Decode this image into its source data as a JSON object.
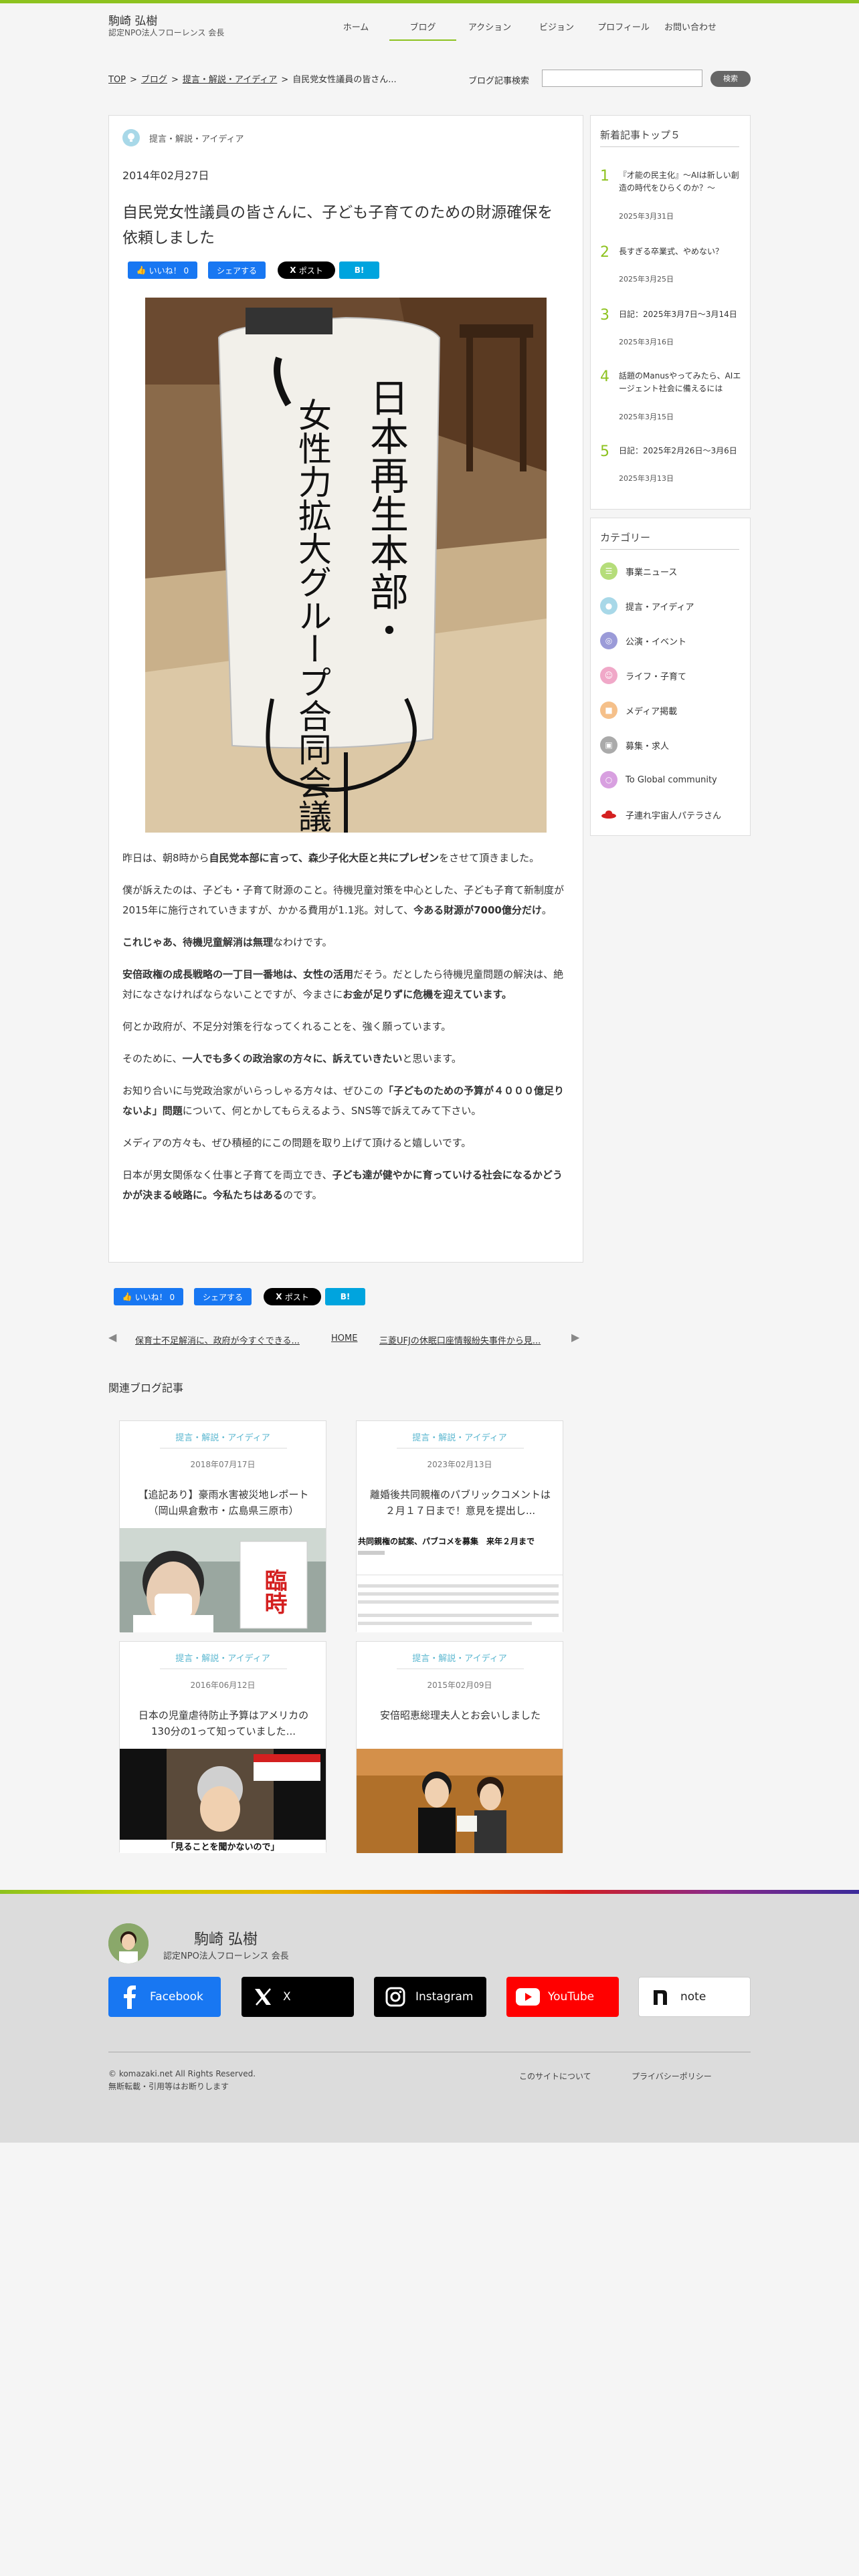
{
  "header": {
    "site_name": "駒崎 弘樹",
    "site_sub": "認定NPO法人フローレンス 会長",
    "nav": [
      "ホーム",
      "ブログ",
      "アクション",
      "ビジョン",
      "プロフィール",
      "お問い合わせ"
    ]
  },
  "breadcrumb": {
    "top": "TOP",
    "blog": "ブログ",
    "category": "提言・解説・アイディア",
    "current": "自民党女性議員の皆さん..."
  },
  "search": {
    "label": "ブログ記事検索",
    "button": "検索"
  },
  "article": {
    "category": "提言・解説・アイディア",
    "date": "2014年02月27日",
    "title": "自民党女性議員の皆さんに、子ども子育てのための財源確保を依頼しました",
    "photo_text": {
      "line1": "日本再生本部・",
      "line2": "女性力拡大グループ合同会議"
    },
    "paragraphs": [
      [
        "昨日は、朝8時から",
        "自民党本部に言って、森少子化大臣と共にプレゼン",
        "をさせて頂きました。"
      ],
      [
        "僕が訴えたのは、子ども・子育て財源のこと。待機児童対策を中心とした、子ども子育て新制度が2015年に施行されていきますが、かかる費用が1.1兆。対して、",
        "今ある財源が7000億分だけ",
        "。"
      ],
      [
        "",
        "これじゃあ、待機児童解消は無理",
        "なわけです。"
      ],
      [
        "",
        "安倍政権の成長戦略の一丁目一番地は、女性の活用",
        "だそう。だとしたら待機児童問題の解決は、絶対になさなければならないことですが、今まさに",
        "お金が足りずに危機を迎えています。"
      ],
      [
        "何とか政府が、不足分対策を行なってくれることを、強く願っています。",
        "",
        ""
      ],
      [
        "そのために、",
        "一人でも多くの政治家の方々に、訴えていきたい",
        "と思います。"
      ],
      [
        "お知り合いに与党政治家がいらっしゃる方々は、ぜひこの",
        "「子どものための予算が４０００億足りないよ」問題",
        "について、何とかしてもらえるよう、SNS等で訴えてみて下さい。"
      ],
      [
        "メディアの方々も、ぜひ積極的にこの問題を取り上げて頂けると嬉しいです。",
        "",
        ""
      ],
      [
        "日本が男女関係なく仕事と子育てを両立でき、",
        "子ども達が健やかに育っていける社会になるかどうかが決まる岐路に。今私たちはある",
        "のです。"
      ]
    ]
  },
  "share": {
    "like": "いいね！ 0",
    "share": "シェアする",
    "post": "ポスト",
    "hatena": "B!"
  },
  "pager": {
    "prev": "保育士不足解消に、政府が今すぐできる...",
    "home": "HOME",
    "next": "三菱UFJの休眠口座情報紛失事件から見..."
  },
  "related": {
    "heading": "関連ブログ記事",
    "cards": [
      {
        "category": "提言・解説・アイディア",
        "date": "2018年07月17日",
        "title": "【追記あり】豪雨水害被災地レポート（岡山県倉敷市・広島県三原市）",
        "img_text": "臨時"
      },
      {
        "category": "提言・解説・アイディア",
        "date": "2023年02月13日",
        "title": "離婚後共同親権のパブリックコメントは２月１７日まで！意見を提出し...",
        "img_text": "共同親権の試案、パブコメを募集　来年２月まで"
      },
      {
        "category": "提言・解説・アイディア",
        "date": "2016年06月12日",
        "title": "日本の児童虐待防止予算はアメリカの130分の1って知っていました...",
        "img_text": "「見ることを聞かないので」"
      },
      {
        "category": "提言・解説・アイディア",
        "date": "2015年02月09日",
        "title": "安倍昭恵総理夫人とお会いしました",
        "img_text": ""
      }
    ]
  },
  "sidebar": {
    "ranking": {
      "heading": "新着記事トップ５",
      "items": [
        {
          "num": "1",
          "title": "『才能の民主化』〜AIは新しい創造の時代をひらくのか？〜",
          "date": "2025年3月31日"
        },
        {
          "num": "2",
          "title": "長すぎる卒業式、やめない？",
          "date": "2025年3月25日"
        },
        {
          "num": "3",
          "title": "日記：2025年3月7日〜3月14日",
          "date": "2025年3月16日"
        },
        {
          "num": "4",
          "title": "話題のManusやってみたら、AIエージェント社会に備えるには",
          "date": "2025年3月15日"
        },
        {
          "num": "5",
          "title": "日記：2025年2月26日〜3月6日",
          "date": "2025年3月13日"
        }
      ]
    },
    "categories": {
      "heading": "カテゴリー",
      "items": [
        {
          "label": "事業ニュース",
          "color": "#b5dd7a"
        },
        {
          "label": "提言・アイディア",
          "color": "#a8d8e8"
        },
        {
          "label": "公演・イベント",
          "color": "#9b9bd8"
        },
        {
          "label": "ライフ・子育て",
          "color": "#f0a8c8"
        },
        {
          "label": "メディア掲載",
          "color": "#f5c08a"
        },
        {
          "label": "募集・求人",
          "color": "#aaaaaa"
        },
        {
          "label": "To Global community",
          "color": "#d8a0e0"
        },
        {
          "label": "子連れ宇宙人パテラさん",
          "color": "#d42020"
        }
      ]
    }
  },
  "footer": {
    "name": "駒崎 弘樹",
    "sub": "認定NPO法人フローレンス 会長",
    "sns": [
      {
        "label": "Facebook",
        "bg": "#1877f2",
        "fg": "#ffffff"
      },
      {
        "label": "X",
        "bg": "#000000",
        "fg": "#ffffff"
      },
      {
        "label": "Instagram",
        "bg": "#000000",
        "fg": "#ffffff"
      },
      {
        "label": "YouTube",
        "bg": "#ff0000",
        "fg": "#ffffff"
      },
      {
        "label": "note",
        "bg": "#ffffff",
        "fg": "#222222"
      }
    ],
    "copy1": "© komazaki.net All Rights Reserved.",
    "copy2": "無断転載・引用等はお断りします",
    "link_about": "このサイトについて",
    "link_privacy": "プライバシーポリシー"
  }
}
